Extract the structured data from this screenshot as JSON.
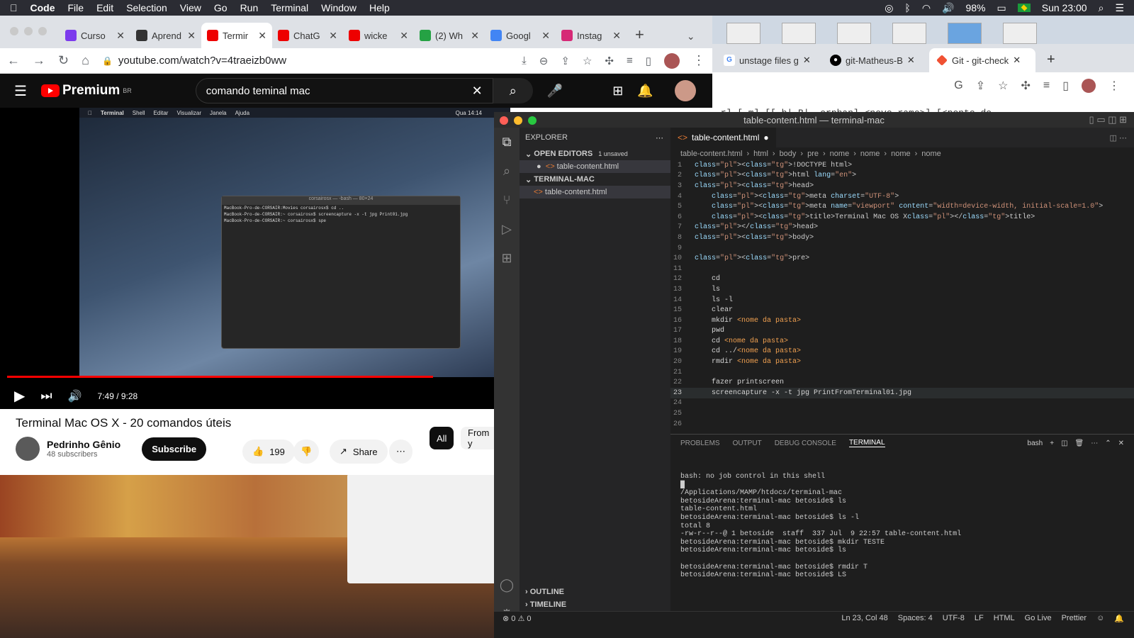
{
  "menubar": {
    "items": [
      "Code",
      "File",
      "Edit",
      "Selection",
      "View",
      "Go",
      "Run",
      "Terminal",
      "Window",
      "Help"
    ],
    "battery": "98%",
    "clock": "Sun 23:00"
  },
  "chrome": {
    "tabs": [
      {
        "label": "Curso",
        "icon": "twitch",
        "color": "#7c3aed"
      },
      {
        "label": "Aprend",
        "icon": "trello",
        "color": "#333"
      },
      {
        "label": "Termir",
        "icon": "youtube",
        "color": "#e00"
      },
      {
        "label": "ChatG",
        "icon": "youtube",
        "color": "#e00"
      },
      {
        "label": "wicke",
        "icon": "youtube",
        "color": "#e00"
      },
      {
        "label": "(2) Wh",
        "icon": "whatsapp",
        "color": "#25a244"
      },
      {
        "label": "Googl",
        "icon": "translate",
        "color": "#4285f4"
      },
      {
        "label": "Instag",
        "icon": "instagram",
        "color": "#d62976"
      }
    ],
    "url": "youtube.com/watch?v=4traeizb0ww"
  },
  "chrome2": {
    "tabs": [
      "unstage files g",
      "git-Matheus-B",
      "Git - git-check"
    ],
    "code_line": "-r] [-m] [[-b|-B|--orphan] <novo-ramo>] [<ponto-de-"
  },
  "youtube": {
    "brand": "Premium",
    "region": "BR",
    "search": "comando teminal mac",
    "video_menubar": [
      "Terminal",
      "Shell",
      "Editar",
      "Visualizar",
      "Janela",
      "Ajuda"
    ],
    "video_clock": "Qua 14:14",
    "video_term_title": "corsairosx — -bash — 80×24",
    "video_term_lines": [
      "MacBook-Pro-de-CORSAIR:Movies corsairosx$ cd ..",
      "MacBook-Pro-de-CORSAIR:~ corsairosx$ screencapture -x -t jpg Print01.jpg",
      "MacBook-Pro-de-CORSAIR:~ corsairosx$ spe"
    ],
    "time": "7:49 / 9:28",
    "progress": 0.846,
    "title": "Terminal Mac OS X - 20 comandos úteis",
    "channel": "Pedrinho Gênio",
    "subscribers": "48 subscribers",
    "subscribe": "Subscribe",
    "likes": "199",
    "share": "Share",
    "chips": [
      "All",
      "From y"
    ]
  },
  "vscode": {
    "title": "table-content.html — terminal-mac",
    "explorer": "EXPLORER",
    "open_editors": "OPEN EDITORS",
    "unsaved": "1 unsaved",
    "open_file": "table-content.html",
    "folder": "TERMINAL-MAC",
    "folder_file": "table-content.html",
    "outline": "OUTLINE",
    "timeline": "TIMELINE",
    "tab": "table-content.html",
    "crumbs": [
      "table-content.html",
      "html",
      "body",
      "pre",
      "nome",
      "nome",
      "nome",
      "nome"
    ],
    "panel_tabs": [
      "PROBLEMS",
      "OUTPUT",
      "DEBUG CONSOLE",
      "TERMINAL"
    ],
    "shell": "bash",
    "terminal": "bash: no job control in this shell\n█\n/Applications/MAMP/htdocs/terminal-mac\nbetosideArena:terminal-mac betoside$ ls\ntable-content.html\nbetosideArena:terminal-mac betoside$ ls -l\ntotal 8\n-rw-r--r--@ 1 betoside  staff  337 Jul  9 22:57 table-content.html\nbetosideArena:terminal-mac betoside$ mkdir TESTE\nbetosideArena:terminal-mac betoside$ ls\n\nbetosideArena:terminal-mac betoside$ rmdir T\nbetosideArena:terminal-mac betoside$ LS",
    "status": {
      "errors": "0",
      "warnings": "0",
      "position": "Ln 23, Col 48",
      "spaces": "Spaces: 4",
      "encoding": "UTF-8",
      "eol": "LF",
      "lang": "HTML",
      "golive": "Go Live",
      "prettier": "Prettier"
    },
    "code_lines": [
      "<!DOCTYPE html>",
      "<html lang=\"en\">",
      "<head>",
      "    <meta charset=\"UTF-8\">",
      "    <meta name=\"viewport\" content=\"width=device-width, initial-scale=1.0\">",
      "    <title>Terminal Mac OS X</title>",
      "</head>",
      "<body>",
      "",
      "<pre>",
      "",
      "    cd",
      "    ls",
      "    ls -l",
      "    clear",
      "    mkdir <nome da pasta>",
      "    pwd",
      "    cd <nome da pasta>",
      "    cd ../<nome da pasta>",
      "    rmdir <nome da pasta>",
      "",
      "    fazer printscreen",
      "    screencapture -x -t jpg PrintFromTerminal01.jpg",
      "",
      "",
      ""
    ]
  }
}
